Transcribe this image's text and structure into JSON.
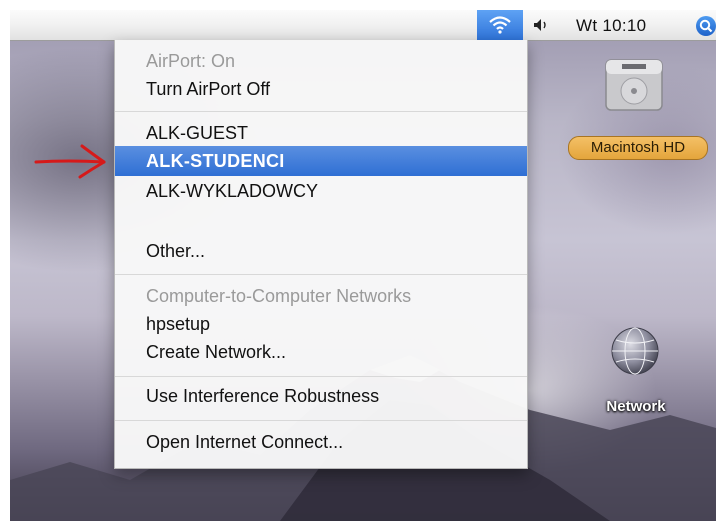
{
  "menubar": {
    "wifi_icon": "wifi-icon",
    "volume_icon": "volume-icon",
    "clock": "Wt 10:10",
    "spotlight_icon": "spotlight-icon",
    "highlight_color": "#2f73d8"
  },
  "airport_menu": {
    "status": "AirPort: On",
    "turn_off": "Turn AirPort Off",
    "networks": [
      "ALK-GUEST",
      "ALK-STUDENCI",
      "ALK-WYKLADOWCY"
    ],
    "selected_network": "ALK-STUDENCI",
    "other": "Other...",
    "computer_networks_header": "Computer-to-Computer Networks",
    "hpsetup": "hpsetup",
    "create_network": "Create Network...",
    "interference": "Use Interference Robustness",
    "open_connect": "Open Internet Connect..."
  },
  "desktop": {
    "macintosh_hd_label": "Macintosh HD",
    "network_label": "Network",
    "arrow_color": "#d61a1a"
  }
}
